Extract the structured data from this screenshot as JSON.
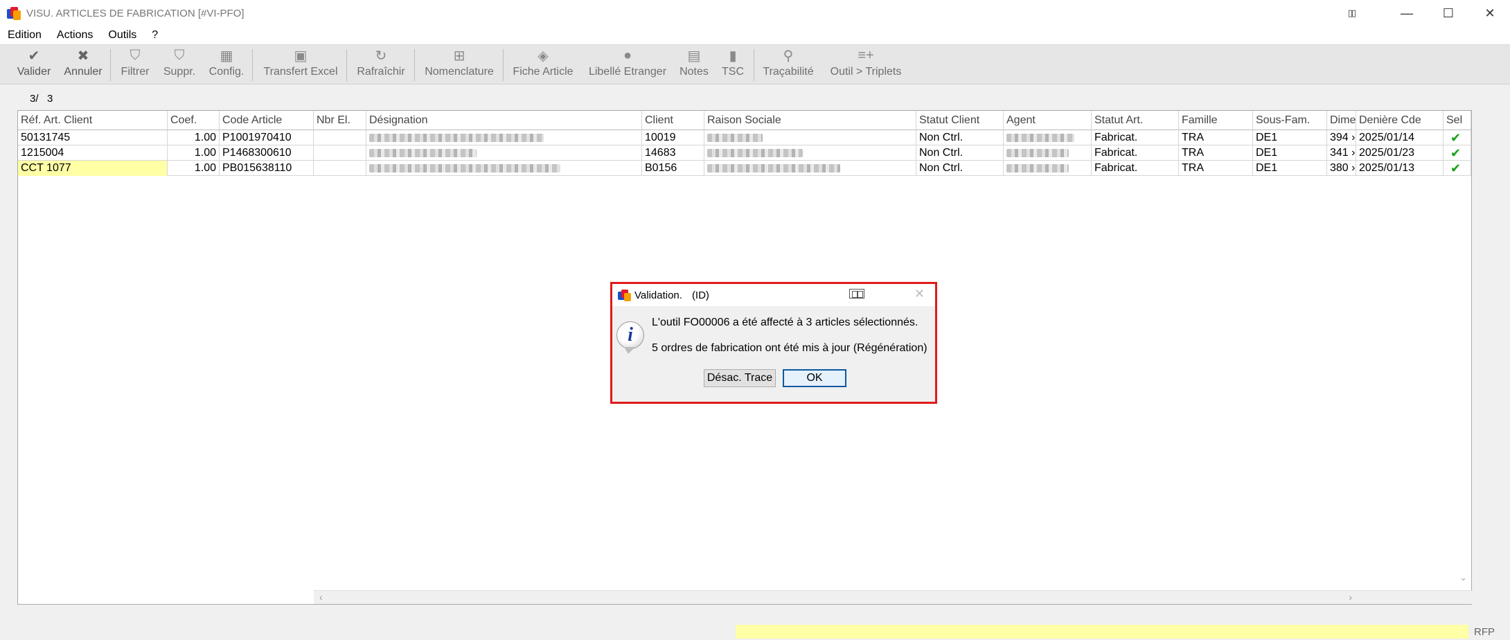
{
  "window": {
    "title": "VISU. ARTICLES DE FABRICATION [#VI-PFO]",
    "restore_glyph": "▯▯",
    "minimize_glyph": "—",
    "maximize_glyph": "☐",
    "close_glyph": "✕"
  },
  "menu": {
    "edition": "Edition",
    "actions": "Actions",
    "outils": "Outils",
    "help": "?"
  },
  "toolbar": {
    "valider": {
      "label": "Valider",
      "icon": "✔"
    },
    "annuler": {
      "label": "Annuler",
      "icon": "✖"
    },
    "filtrer": {
      "label": "Filtrer",
      "icon": "⛉"
    },
    "suppr": {
      "label": "Suppr.",
      "icon": "⛉"
    },
    "config": {
      "label": "Config.",
      "icon": "▦"
    },
    "transfert": {
      "label": "Transfert Excel",
      "icon": "▣"
    },
    "rafraichir": {
      "label": "Rafraîchir",
      "icon": "↻"
    },
    "nomenclature": {
      "label": "Nomenclature",
      "icon": "⊞"
    },
    "fiche": {
      "label": "Fiche Article",
      "icon": "◈"
    },
    "libelle": {
      "label": "Libellé Etranger",
      "icon": "●"
    },
    "notes": {
      "label": "Notes",
      "icon": "▤"
    },
    "tsc": {
      "label": "TSC",
      "icon": "▮"
    },
    "tracabilite": {
      "label": "Traçabilité",
      "icon": "⚲"
    },
    "triplets": {
      "label": "Outil > Triplets",
      "icon": "≡+"
    }
  },
  "counter": {
    "current": "3/",
    "total": "3"
  },
  "grid": {
    "headers": {
      "ref": "Réf. Art. Client",
      "coef": "Coef.",
      "code": "Code Article",
      "nbr": "Nbr El.",
      "designation": "Désignation",
      "client": "Client",
      "raison": "Raison Sociale",
      "statut_client": "Statut Client",
      "agent": "Agent",
      "statut_art": "Statut Art.",
      "famille": "Famille",
      "sous_fam": "Sous-Fam.",
      "dime": "Dime",
      "derniere": "Denière Cde",
      "sel": "Sel"
    },
    "rows": [
      {
        "ref": "50131745",
        "coef": "1.00",
        "code": "P1001970410",
        "client": "10019",
        "statut_client": "Non Ctrl.",
        "statut_art": "Fabricat.",
        "famille": "TRA",
        "sous_fam": "DE1",
        "dime": "394 ›",
        "derniere": "2025/01/14",
        "sel": "✔"
      },
      {
        "ref": "1215004",
        "coef": "1.00",
        "code": "P1468300610",
        "client": "14683",
        "statut_client": "Non Ctrl.",
        "statut_art": "Fabricat.",
        "famille": "TRA",
        "sous_fam": "DE1",
        "dime": "341 ›",
        "derniere": "2025/01/23",
        "sel": "✔"
      },
      {
        "ref": "CCT 1077",
        "coef": "1.00",
        "code": "PB015638110",
        "client": "B0156",
        "statut_client": "Non Ctrl.",
        "statut_art": "Fabricat.",
        "famille": "TRA",
        "sous_fam": "DE1",
        "dime": "380 ›",
        "derniere": "2025/01/13",
        "sel": "✔"
      }
    ],
    "scroll_left": "‹",
    "scroll_right": "›",
    "scroll_down": "⌄"
  },
  "status": {
    "rfp": "RFP"
  },
  "dialog": {
    "title": "Validation.",
    "title_suffix": "(ID)",
    "close_glyph": "✕",
    "info_glyph": "i",
    "message_1": "L'outil FO00006 a été affecté à 3 articles sélectionnés.",
    "message_2": "5 ordres de fabrication ont été mis à jour (Régénération)",
    "btn_trace": "Désac. Trace",
    "btn_ok": "OK"
  },
  "colors": {
    "highlight_yellow": "#ffffa6",
    "dialog_border": "#e01a1a",
    "check_green": "#1aa01a",
    "ok_border": "#0a5a9e"
  }
}
